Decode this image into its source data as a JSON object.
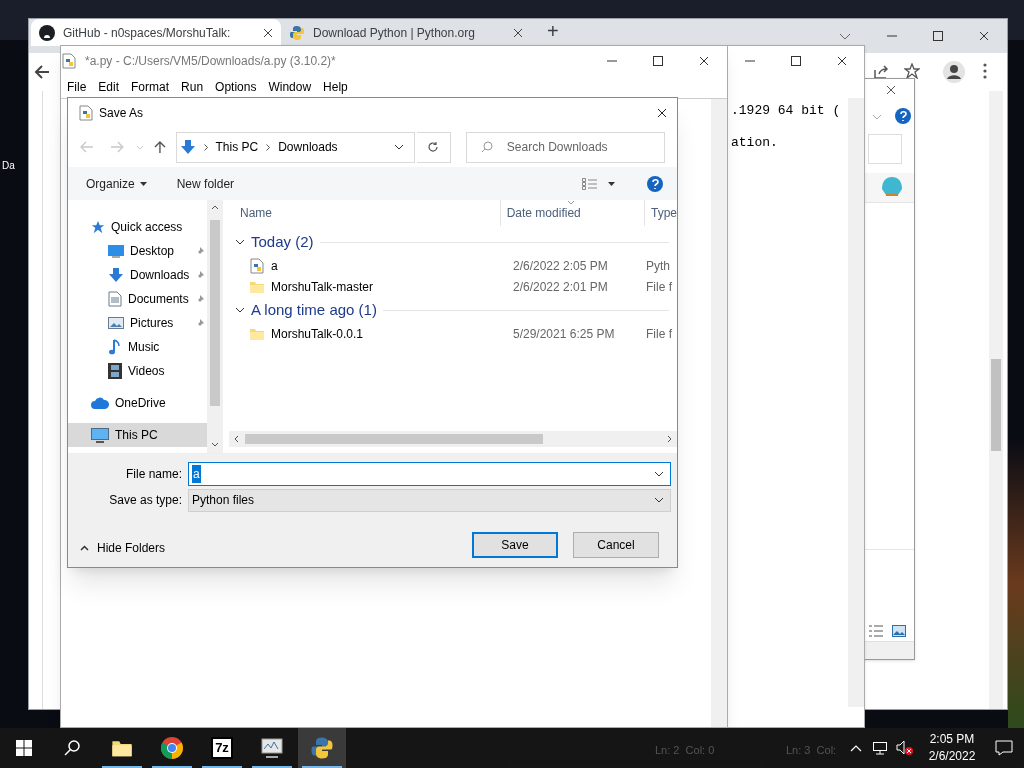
{
  "desktop": {
    "icon_label": "Da"
  },
  "browser": {
    "tabs": [
      {
        "title": "GitHub - n0spaces/MorshuTalk:",
        "selected": true
      },
      {
        "title": "Download Python | Python.org",
        "selected": false
      }
    ],
    "new_tab": "+"
  },
  "shell_window": {
    "lines": [
      ".1929 64 bit (",
      "ation."
    ],
    "status": "Ln: 3  Col:"
  },
  "editor": {
    "title": "*a.py - C:/Users/VM5/Downloads/a.py (3.10.2)*",
    "menu": [
      "File",
      "Edit",
      "Format",
      "Run",
      "Options",
      "Window",
      "Help"
    ],
    "status": "Ln: 2  Col: 0"
  },
  "save_dialog": {
    "title": "Save As",
    "breadcrumb": [
      "This PC",
      "Downloads"
    ],
    "search": {
      "placeholder": "Search Downloads"
    },
    "toolbar": {
      "organize": "Organize",
      "new_folder": "New folder"
    },
    "nav": [
      {
        "label": "Quick access",
        "selected": false,
        "children": [
          {
            "label": "Desktop",
            "pinned": true,
            "selected": false
          },
          {
            "label": "Downloads",
            "pinned": true,
            "selected": false
          },
          {
            "label": "Documents",
            "pinned": true,
            "selected": false
          },
          {
            "label": "Pictures",
            "pinned": true,
            "selected": false
          },
          {
            "label": "Music",
            "pinned": false,
            "selected": false
          },
          {
            "label": "Videos",
            "pinned": false,
            "selected": false
          }
        ]
      },
      {
        "label": "OneDrive",
        "selected": false
      },
      {
        "label": "This PC",
        "selected": true
      }
    ],
    "columns": [
      "Name",
      "Date modified",
      "Type"
    ],
    "groups": [
      {
        "label": "Today (2)",
        "expanded": true,
        "files": [
          {
            "name": "a",
            "date": "2/6/2022 2:05 PM",
            "type": "Pyth",
            "kind": "python"
          },
          {
            "name": "MorshuTalk-master",
            "date": "2/6/2022 2:01 PM",
            "type": "File f",
            "kind": "folder"
          }
        ]
      },
      {
        "label": "A long time ago (1)",
        "expanded": true,
        "files": [
          {
            "name": "MorshuTalk-0.0.1",
            "date": "5/29/2021 6:25 PM",
            "type": "File f",
            "kind": "folder"
          }
        ]
      }
    ],
    "file_name": {
      "label": "File name:",
      "value": "a"
    },
    "save_as_type": {
      "label": "Save as type:",
      "value": "Python files"
    },
    "hide_folders": "Hide Folders",
    "buttons": [
      {
        "label": "Save",
        "default": true
      },
      {
        "label": "Cancel",
        "default": false
      }
    ]
  },
  "taskbar": {
    "apps": [
      {
        "kind": "folder",
        "active": false
      },
      {
        "kind": "browser",
        "active": false
      },
      {
        "kind": "archiver",
        "label": "7z",
        "active": false
      },
      {
        "kind": "monitor",
        "active": false
      },
      {
        "kind": "python",
        "active": true
      }
    ],
    "clock": {
      "time": "2:05 PM",
      "date": "2/6/2022"
    }
  }
}
